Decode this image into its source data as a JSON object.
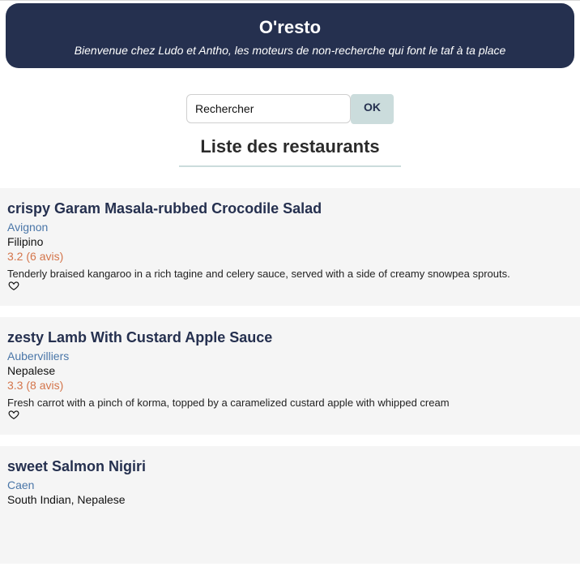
{
  "header": {
    "title": "O'resto",
    "subtitle": "Bienvenue chez Ludo et Antho, les moteurs de non-recherche qui font le taf à ta place"
  },
  "search": {
    "placeholder": "Rechercher",
    "value": "",
    "button_label": "OK"
  },
  "list": {
    "title": "Liste des restaurants",
    "items": [
      {
        "name": "crispy Garam Masala-rubbed Crocodile Salad",
        "city": "Avignon",
        "cuisine": "Filipino",
        "rating": "3.2 (6 avis)",
        "description": "Tenderly braised kangaroo in a rich tagine and celery sauce, served with a side of creamy snowpea sprouts.",
        "favorite_icon": "heart-outline-icon"
      },
      {
        "name": "zesty Lamb With Custard Apple Sauce",
        "city": "Aubervilliers",
        "cuisine": "Nepalese",
        "rating": "3.3 (8 avis)",
        "description": "Fresh carrot with a pinch of korma, topped by a caramelized custard apple with whipped cream",
        "favorite_icon": "heart-outline-icon"
      },
      {
        "name": "sweet Salmon Nigiri",
        "city": "Caen",
        "cuisine": "South Indian, Nepalese",
        "rating": "",
        "description": "",
        "favorite_icon": "heart-outline-icon"
      }
    ]
  },
  "colors": {
    "header_bg": "#25304f",
    "accent": "#cbdcdc",
    "city": "#4a76a8",
    "rating": "#d4754b",
    "card_bg": "#f5f5f5"
  }
}
